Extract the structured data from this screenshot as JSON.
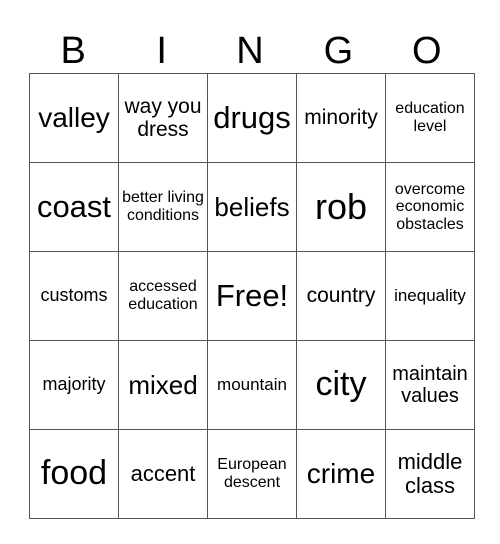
{
  "header": [
    "B",
    "I",
    "N",
    "G",
    "O"
  ],
  "rows": [
    [
      "valley",
      "way you dress",
      "drugs",
      "minority",
      "education level"
    ],
    [
      "coast",
      "better living conditions",
      "beliefs",
      "rob",
      "overcome economic obstacles"
    ],
    [
      "customs",
      "accessed education",
      "Free!",
      "country",
      "inequality"
    ],
    [
      "majority",
      "mixed",
      "mountain",
      "city",
      "maintain values"
    ],
    [
      "food",
      "accent",
      "European descent",
      "crime",
      "middle class"
    ]
  ]
}
